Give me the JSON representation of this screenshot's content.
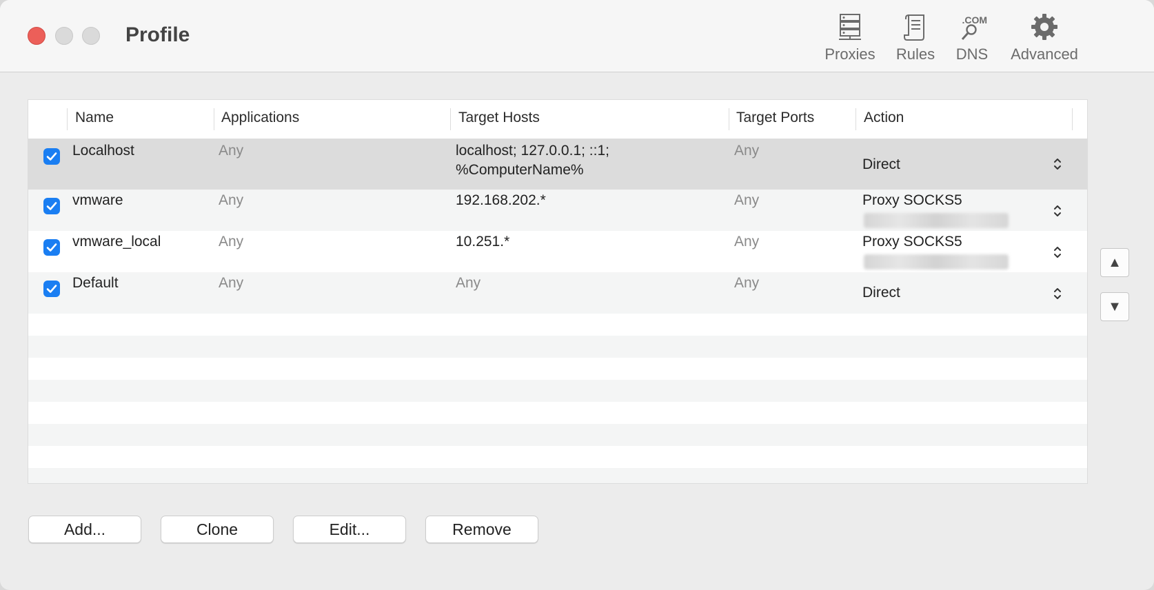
{
  "window": {
    "title": "Profile"
  },
  "toolbar": {
    "proxies": "Proxies",
    "rules": "Rules",
    "dns": "DNS",
    "dns_badge": ".COM",
    "advanced": "Advanced"
  },
  "table": {
    "headers": [
      "Name",
      "Applications",
      "Target Hosts",
      "Target Ports",
      "Action"
    ],
    "rows": [
      {
        "checked": true,
        "name": "Localhost",
        "applications": "Any",
        "hosts_line1": "localhost; 127.0.0.1; ::1;",
        "hosts_line2": "%ComputerName%",
        "ports": "Any",
        "action": "Direct"
      },
      {
        "checked": true,
        "name": "vmware",
        "applications": "Any",
        "hosts_line1": "192.168.202.*",
        "ports": "Any",
        "action": "Proxy SOCKS5"
      },
      {
        "checked": true,
        "name": "vmware_local",
        "applications": "Any",
        "hosts_line1": "10.251.*",
        "ports": "Any",
        "action": "Proxy SOCKS5"
      },
      {
        "checked": true,
        "name": "Default",
        "applications": "Any",
        "hosts_line1": "Any",
        "ports": "Any",
        "action": "Direct"
      }
    ]
  },
  "side_buttons": {
    "up": "▲",
    "down": "▼"
  },
  "buttons": {
    "add": "Add...",
    "clone": "Clone",
    "edit": "Edit...",
    "remove": "Remove"
  },
  "colors": {
    "accent": "#1a7ef2",
    "close": "#ec5f59"
  }
}
